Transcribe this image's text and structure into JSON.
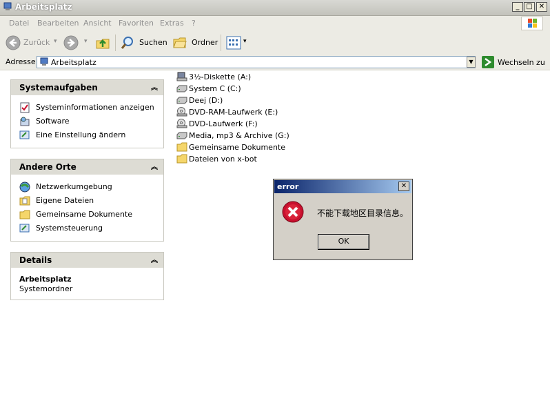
{
  "window": {
    "title": "Arbeitsplatz"
  },
  "menu": [
    "Datei",
    "Bearbeiten",
    "Ansicht",
    "Favoriten",
    "Extras",
    "?"
  ],
  "toolbar": {
    "back": "Zurück",
    "search": "Suchen",
    "folders": "Ordner"
  },
  "address": {
    "label": "Adresse",
    "value": "Arbeitsplatz",
    "go": "Wechseln zu"
  },
  "panels": {
    "system_tasks": {
      "title": "Systemaufgaben",
      "items": [
        "Systeminformationen anzeigen",
        "Software",
        "Eine Einstellung ändern"
      ]
    },
    "other_places": {
      "title": "Andere Orte",
      "items": [
        "Netzwerkumgebung",
        "Eigene Dateien",
        "Gemeinsame Dokumente",
        "Systemsteuerung"
      ]
    },
    "details": {
      "title": "Details",
      "name": "Arbeitsplatz",
      "type": "Systemordner"
    }
  },
  "drives": [
    "3½-Diskette (A:)",
    "System C (C:)",
    "Deej (D:)",
    "DVD-RAM-Laufwerk (E:)",
    "DVD-Laufwerk (F:)",
    "Media, mp3 & Archive (G:)",
    "Gemeinsame Dokumente",
    "Dateien von x-bot"
  ],
  "dialog": {
    "title": "error",
    "message": "不能下载地区目录信息。",
    "ok": "OK"
  },
  "colors": {
    "error_red": "#c8102e",
    "dialog_title": "#0a246a",
    "go_green": "#2e8b2e"
  }
}
